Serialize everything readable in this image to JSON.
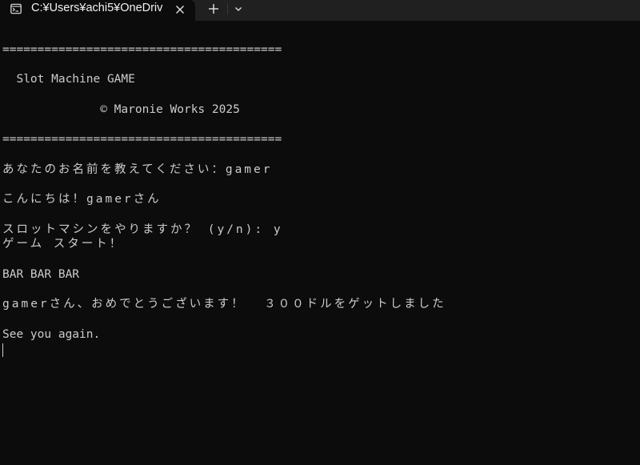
{
  "tabbar": {
    "tab_title": "C:¥Users¥achi5¥OneDriv",
    "tab_icon": "terminal-icon",
    "close_icon": "close-icon",
    "new_tab_icon": "plus-icon",
    "dropdown_icon": "chevron-down-icon"
  },
  "terminal": {
    "separator_top": "========================================",
    "title": "  Slot Machine GAME",
    "copyright": "              © Maronie Works 2025",
    "separator_bottom": "========================================",
    "name_prompt": "あなたのお名前を教えてください：gamer",
    "greeting": "こんにちは！gamerさん",
    "play_prompt": "スロットマシンをやりますか？ (y/n): y",
    "game_start": "ゲーム スタート！",
    "reels": "BAR BAR BAR",
    "result": "gamerさん、おめでとうございます！  ３００ドルをゲットしました",
    "farewell": "See you again."
  },
  "colors": {
    "background": "#0c0c0c",
    "tabbar": "#202020",
    "text": "#cccccc"
  }
}
